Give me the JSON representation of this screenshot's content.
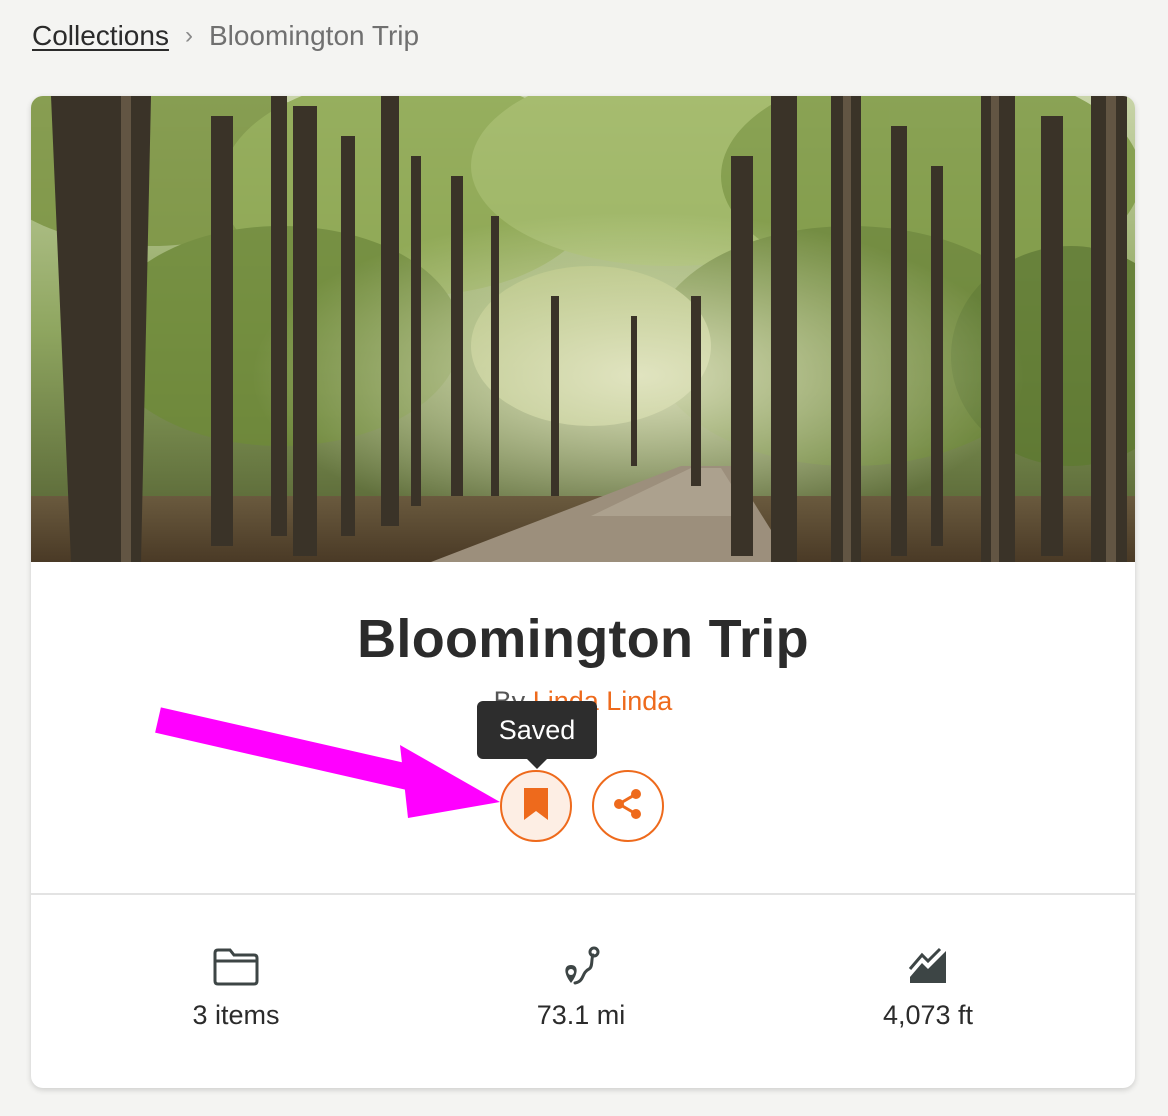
{
  "breadcrumb": {
    "root_label": "Collections",
    "separator": "›",
    "current_label": "Bloomington Trip"
  },
  "collection": {
    "title": "Bloomington Trip",
    "author_prefix": "By ",
    "author_name": "Linda Linda"
  },
  "actions": {
    "save_tooltip": "Saved",
    "save_icon": "bookmark-icon",
    "share_icon": "share-icon"
  },
  "stats": {
    "items": {
      "icon": "folder-icon",
      "value": "3 items"
    },
    "distance": {
      "icon": "route-icon",
      "value": "73.1 mi"
    },
    "elevation": {
      "icon": "elevation-icon",
      "value": "4,073 ft"
    }
  },
  "colors": {
    "accent": "#ee6a1c",
    "annotation": "#ff00ff",
    "icon_dark": "#3d4545"
  }
}
